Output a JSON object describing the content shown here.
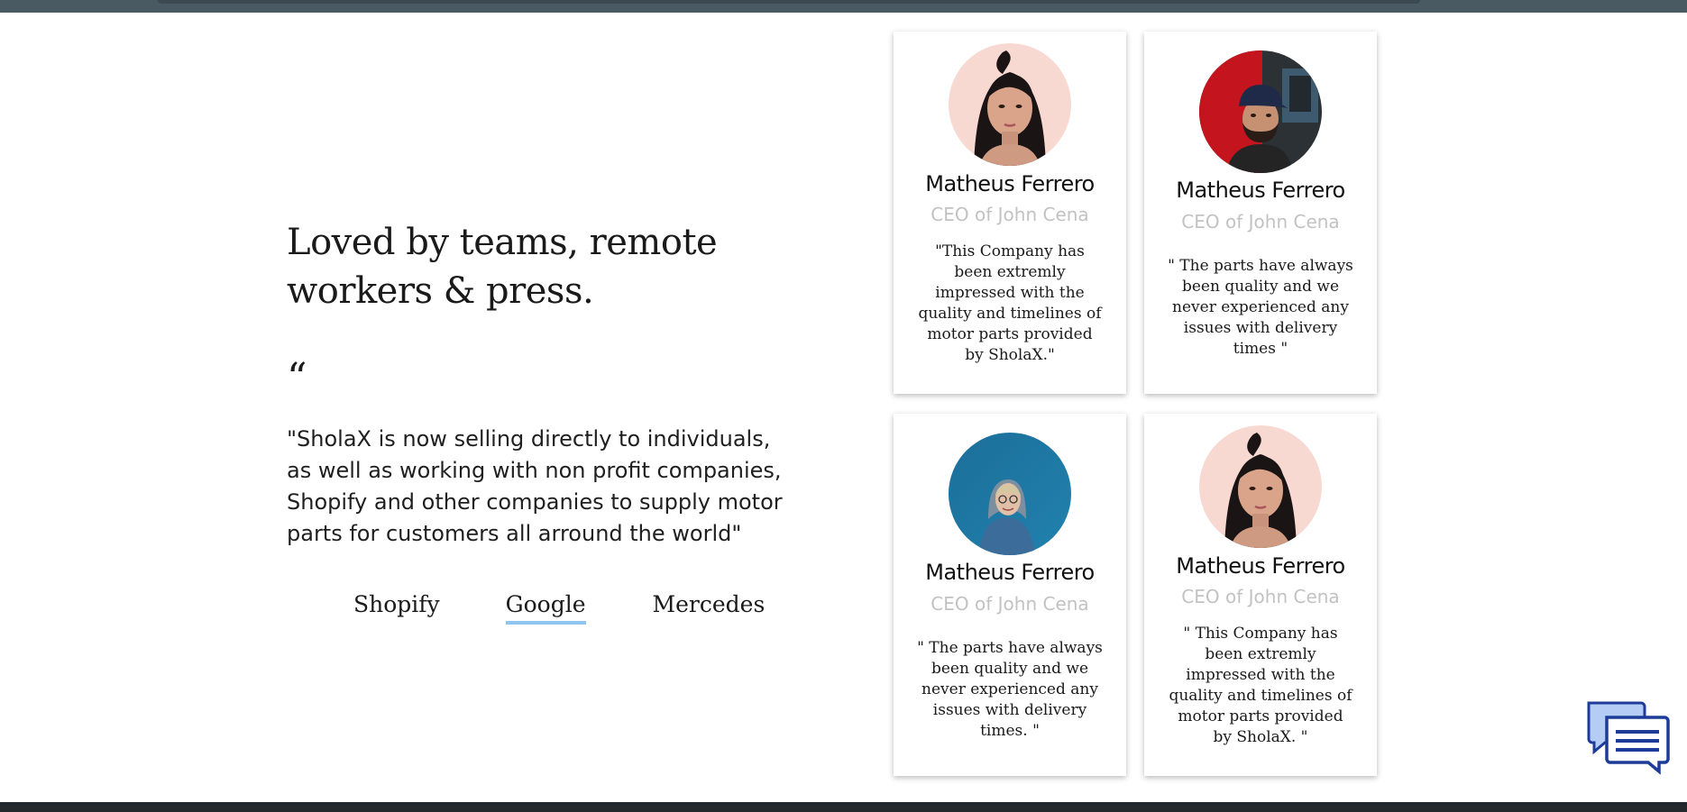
{
  "section": {
    "headline": "Loved by teams, remote workers & press.",
    "quote_mark": "“",
    "quote": "\"SholaX is now selling directly to individuals, as well as working with non profit companies, Shopify and other companies to supply motor parts for customers all arround the world\""
  },
  "company_tabs": [
    {
      "label": "Shopify",
      "active": false
    },
    {
      "label": "Google",
      "active": true
    },
    {
      "label": "Mercedes",
      "active": false
    }
  ],
  "cards": [
    {
      "name": "Matheus Ferrero",
      "role": "CEO of John Cena",
      "text": "\"This Company has been extremly impressed with the quality and timelines of motor parts provided by SholaX.\"",
      "avatar": "woman-portrait-pink-background"
    },
    {
      "name": "Matheus Ferrero",
      "role": "CEO of John Cena",
      "text": "\" The parts have always been quality and we never experienced any issues with delivery times \"",
      "avatar": "man-with-cap-red-background"
    },
    {
      "name": "Matheus Ferrero",
      "role": "CEO of John Cena",
      "text": "\" The parts have always been quality and we never experienced any issues with delivery times. \"",
      "avatar": "woman-hoodie-blue-wall"
    },
    {
      "name": "Matheus Ferrero",
      "role": "CEO of John Cena",
      "text": "\" This Company has been extremly impressed with the quality and timelines of motor parts provided by SholaX. \"",
      "avatar": "woman-portrait-pink-background"
    }
  ],
  "chat_widget": {
    "icon": "chat-bubbles-icon"
  },
  "colors": {
    "tab_underline": "#8ec4ee",
    "role_text": "#c2c2c2",
    "top_bar": "#4a5a63",
    "chat_blue": "#1d3c9a"
  }
}
